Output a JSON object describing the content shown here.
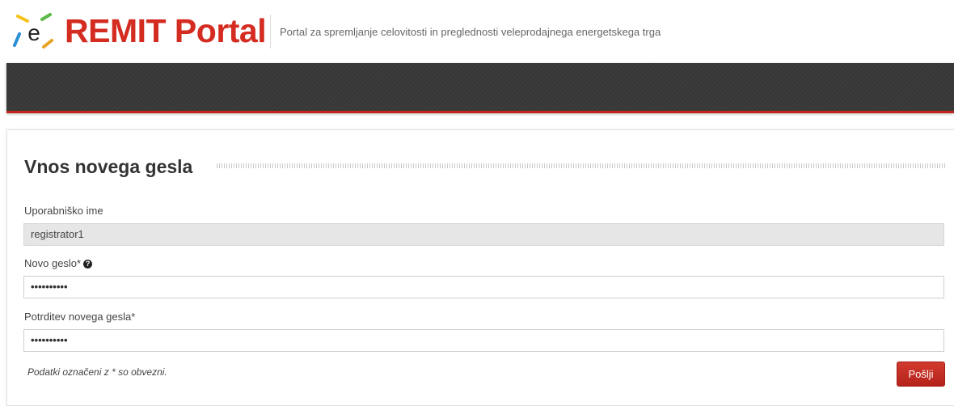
{
  "header": {
    "brand": "REMIT Portal",
    "logo_letter": "e",
    "tagline": "Portal za spremljanje celovitosti in preglednosti veleprodajnega energetskega trga"
  },
  "form": {
    "title": "Vnos novega gesla",
    "username_label": "Uporabniško ime",
    "username_value": "registrator1",
    "new_password_label": "Novo geslo*",
    "help_icon_glyph": "?",
    "new_password_value": "••••••••••",
    "confirm_password_label": "Potrditev novega gesla*",
    "confirm_password_value": "••••••••••",
    "required_note": "Podatki označeni z * so obvezni.",
    "submit_label": "Pošlji"
  },
  "colors": {
    "brand_red": "#d42c21",
    "navbar_dark": "#3a3a3a",
    "navbar_accent": "#c6251d",
    "button_red": "#c02a20"
  },
  "icons": {
    "logo": "remit-e-logo-icon",
    "help": "question-circle-icon"
  }
}
